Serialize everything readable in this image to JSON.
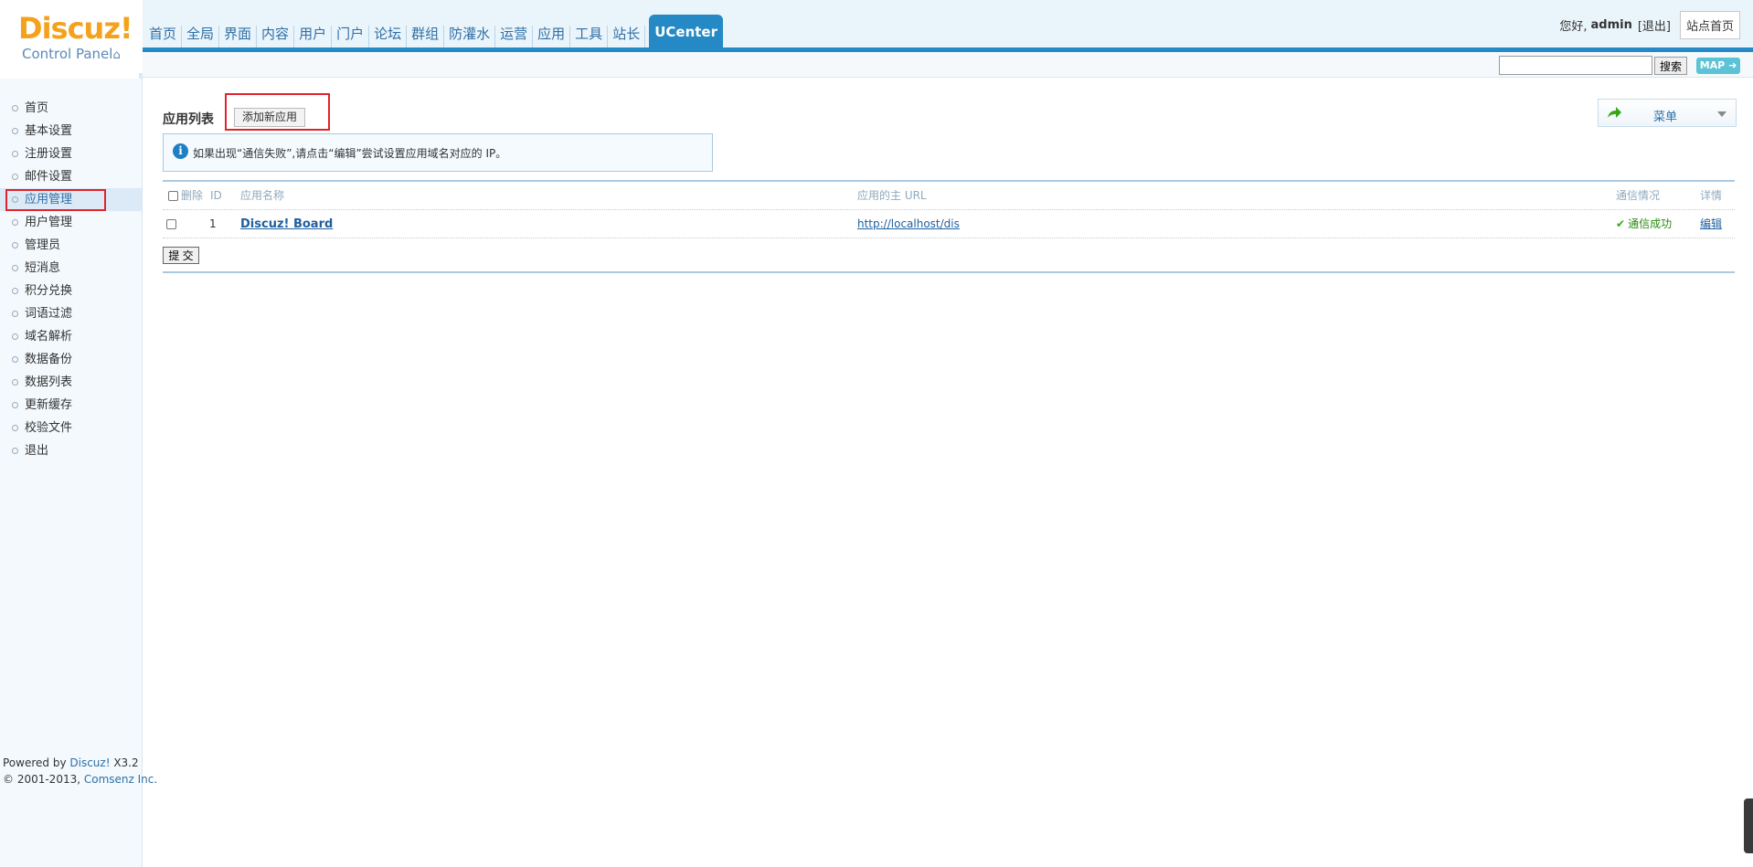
{
  "logo": {
    "brand": "Discuz!",
    "subtitle": "Control Panel"
  },
  "nav": {
    "items": [
      "首页",
      "全局",
      "界面",
      "内容",
      "用户",
      "门户",
      "论坛",
      "群组",
      "防灌水",
      "运营",
      "应用",
      "工具",
      "站长"
    ],
    "active": "UCenter"
  },
  "user": {
    "greeting": "您好,",
    "name": "admin",
    "logout": "[退出]",
    "site_home": "站点首页"
  },
  "search": {
    "value": "",
    "button": "搜索",
    "map": "MAP"
  },
  "sidebar": {
    "items": [
      "首页",
      "基本设置",
      "注册设置",
      "邮件设置",
      "应用管理",
      "用户管理",
      "管理员",
      "短消息",
      "积分兑换",
      "词语过滤",
      "域名解析",
      "数据备份",
      "数据列表",
      "更新缓存",
      "校验文件",
      "退出"
    ],
    "active_index": 4
  },
  "footer": {
    "powered_prefix": "Powered by ",
    "powered_link": "Discuz!",
    "version": " X3.2",
    "copyright_prefix": "© 2001-2013, ",
    "company": "Comsenz Inc."
  },
  "main": {
    "title": "应用列表",
    "add_button": "添加新应用",
    "menu_label": "菜单",
    "tip": "如果出现“通信失败”,请点击“编辑”尝试设置应用域名对应的 IP。",
    "table": {
      "headers": {
        "delete": "删除",
        "id": "ID",
        "name": "应用名称",
        "url": "应用的主 URL",
        "status": "通信情况",
        "detail": "详情"
      },
      "rows": [
        {
          "id": "1",
          "name": "Discuz! Board",
          "url": "http://localhost/dis",
          "status": "通信成功",
          "detail": "编辑"
        }
      ]
    },
    "submit": "提 交"
  },
  "colors": {
    "accent": "#2489c5",
    "highlight": "#e0242b",
    "brand": "#f4a21b",
    "success": "#3aa41a"
  }
}
